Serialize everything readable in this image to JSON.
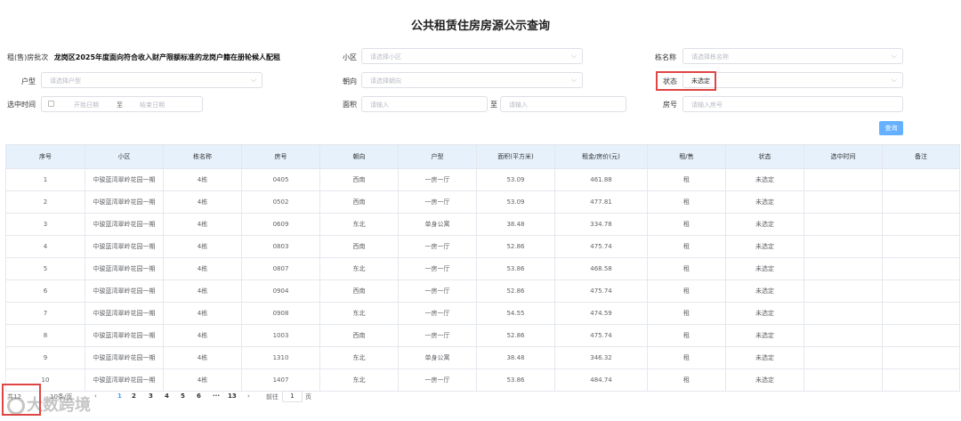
{
  "page": {
    "title": "公共租赁住房房源公示查询"
  },
  "filters": {
    "batch_label": "租(售)房批次",
    "batch_value": "龙岗区2025年度面向符合收入财产限额标准的龙岗户籍在册轮候人配租",
    "community_label": "小区",
    "community_placeholder": "请选择小区",
    "building_label": "栋名称",
    "building_placeholder": "请选择栋名称",
    "unit_type_label": "户型",
    "unit_type_placeholder": "请选择户型",
    "orientation_label": "朝向",
    "orientation_placeholder": "请选择朝向",
    "status_label": "状态",
    "status_value": "未选定",
    "time_label": "选中时间",
    "start_date_placeholder": "开始日期",
    "date_sep": "至",
    "end_date_placeholder": "结束日期",
    "area_label": "面积",
    "area_min_placeholder": "请输入",
    "area_sep": "至",
    "area_max_placeholder": "请输入",
    "room_label": "房号",
    "room_placeholder": "请输入房号",
    "query_button": "查询"
  },
  "table": {
    "headers": [
      "序号",
      "小区",
      "栋名称",
      "房号",
      "朝向",
      "户型",
      "面积(平方米)",
      "租金/房价(元)",
      "租/售",
      "状态",
      "选中时间",
      "备注"
    ],
    "rows": [
      [
        "1",
        "中骏蓝湾翠岭花园一期",
        "4栋",
        "0405",
        "西南",
        "一房一厅",
        "53.09",
        "461.88",
        "租",
        "未选定",
        "",
        ""
      ],
      [
        "2",
        "中骏蓝湾翠岭花园一期",
        "4栋",
        "0502",
        "西南",
        "一房一厅",
        "53.09",
        "477.81",
        "租",
        "未选定",
        "",
        ""
      ],
      [
        "3",
        "中骏蓝湾翠岭花园一期",
        "4栋",
        "0609",
        "东北",
        "单身公寓",
        "38.48",
        "334.78",
        "租",
        "未选定",
        "",
        ""
      ],
      [
        "4",
        "中骏蓝湾翠岭花园一期",
        "4栋",
        "0803",
        "西南",
        "一房一厅",
        "52.86",
        "475.74",
        "租",
        "未选定",
        "",
        ""
      ],
      [
        "5",
        "中骏蓝湾翠岭花园一期",
        "4栋",
        "0807",
        "东北",
        "一房一厅",
        "53.86",
        "468.58",
        "租",
        "未选定",
        "",
        ""
      ],
      [
        "6",
        "中骏蓝湾翠岭花园一期",
        "4栋",
        "0904",
        "西南",
        "一房一厅",
        "52.86",
        "475.74",
        "租",
        "未选定",
        "",
        ""
      ],
      [
        "7",
        "中骏蓝湾翠岭花园一期",
        "4栋",
        "0908",
        "东北",
        "一房一厅",
        "54.55",
        "474.59",
        "租",
        "未选定",
        "",
        ""
      ],
      [
        "8",
        "中骏蓝湾翠岭花园一期",
        "4栋",
        "1003",
        "西南",
        "一房一厅",
        "52.86",
        "475.74",
        "租",
        "未选定",
        "",
        ""
      ],
      [
        "9",
        "中骏蓝湾翠岭花园一期",
        "4栋",
        "1310",
        "东北",
        "单身公寓",
        "38.48",
        "346.32",
        "租",
        "未选定",
        "",
        ""
      ],
      [
        "10",
        "中骏蓝湾翠岭花园一期",
        "4栋",
        "1407",
        "东北",
        "一房一厅",
        "53.86",
        "484.74",
        "租",
        "未选定",
        "",
        ""
      ]
    ]
  },
  "pagination": {
    "total_partial": "共12",
    "page_size_partial": "10条/页",
    "pages": [
      "1",
      "2",
      "3",
      "4",
      "5",
      "6",
      "···",
      "13"
    ],
    "prev": "‹",
    "next": "›",
    "goto_label": "前往",
    "goto_value": "1",
    "goto_suffix": "页"
  },
  "watermark": {
    "text": "大数跨境"
  },
  "colors": {
    "header_bg": "#e6f1fc",
    "button_bg": "#66b1ff",
    "highlight": "#e04545"
  }
}
